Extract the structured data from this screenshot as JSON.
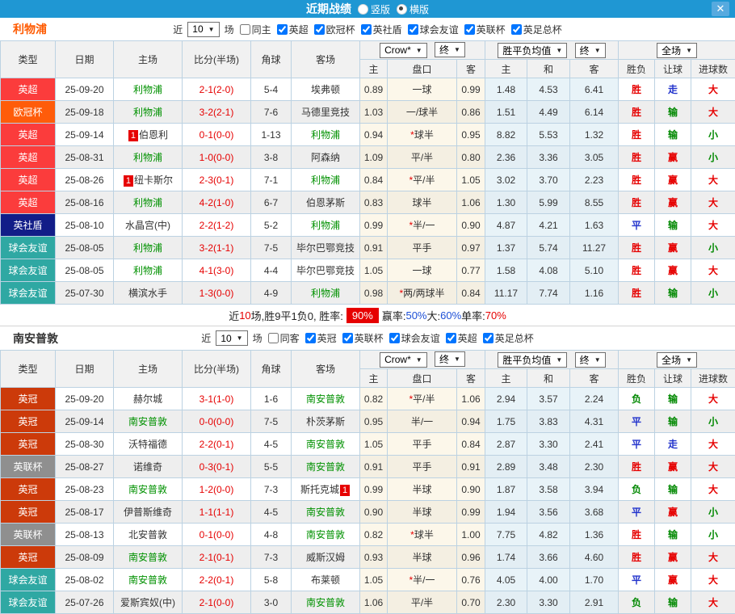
{
  "titlebar": {
    "title": "近期战绩",
    "radio_vertical": "竖版",
    "radio_horizontal": "横版",
    "close": "✕"
  },
  "filters_common": {
    "near_label": "近",
    "near_value": "10",
    "games_label": "场"
  },
  "header": {
    "static_cols": [
      "类型",
      "日期",
      "主场",
      "比分(半场)",
      "角球",
      "客场"
    ],
    "selects": {
      "odds": "Crow*",
      "final1": "终",
      "avg": "胜平负均值",
      "final2": "终",
      "full": "全场"
    },
    "sub_cols": [
      "主",
      "盘口",
      "客",
      "主",
      "和",
      "客",
      "胜负",
      "让球",
      "进球数"
    ]
  },
  "colors": {
    "outcome_map": {
      "胜": "#e60000",
      "平": "#2233cc",
      "负": "#008800",
      "赢": "#e60000",
      "输": "#008800",
      "走": "#2233cc",
      "大": "#e60000",
      "小": "#008800"
    },
    "league_map": {
      "英超": "#fb3c3c",
      "欧冠杯": "#ff5c0a",
      "英社盾": "#121d88",
      "球会友谊": "#2fa8a3",
      "英冠": "#cc3a0a",
      "英联杯": "#8f8f8f"
    },
    "self_team": "#009100",
    "score": "#e60000"
  },
  "teams": [
    {
      "name": "利物浦",
      "name_color": "#ff5a00",
      "same_label": "同主",
      "same_checked": false,
      "leagues": [
        "英超",
        "欧冠杯",
        "英社盾",
        "球会友谊",
        "英联杯",
        "英足总杯"
      ],
      "rows": [
        {
          "l": "英超",
          "d": "25-09-20",
          "h": "利物浦",
          "hs": 1,
          "hb": "",
          "score": "2-1(2-0)",
          "c": "5-4",
          "a": "埃弗顿",
          "as": 0,
          "ab": "",
          "o1": "0.89",
          "st": 0,
          "pan": "一球",
          "o2": "0.99",
          "m1": "1.48",
          "m2": "4.53",
          "m3": "6.41",
          "r": "胜",
          "lt": "走",
          "g": "大"
        },
        {
          "l": "欧冠杯",
          "d": "25-09-18",
          "h": "利物浦",
          "hs": 1,
          "hb": "",
          "score": "3-2(2-1)",
          "c": "7-6",
          "a": "马德里竞技",
          "as": 0,
          "ab": "",
          "o1": "1.03",
          "st": 0,
          "pan": "一/球半",
          "o2": "0.86",
          "m1": "1.51",
          "m2": "4.49",
          "m3": "6.14",
          "r": "胜",
          "lt": "输",
          "g": "大"
        },
        {
          "l": "英超",
          "d": "25-09-14",
          "h": "伯恩利",
          "hs": 0,
          "hb": "1",
          "score": "0-1(0-0)",
          "c": "1-13",
          "a": "利物浦",
          "as": 1,
          "ab": "",
          "o1": "0.94",
          "st": 1,
          "pan": "球半",
          "o2": "0.95",
          "m1": "8.82",
          "m2": "5.53",
          "m3": "1.32",
          "r": "胜",
          "lt": "输",
          "g": "小"
        },
        {
          "l": "英超",
          "d": "25-08-31",
          "h": "利物浦",
          "hs": 1,
          "hb": "",
          "score": "1-0(0-0)",
          "c": "3-8",
          "a": "阿森纳",
          "as": 0,
          "ab": "",
          "o1": "1.09",
          "st": 0,
          "pan": "平/半",
          "o2": "0.80",
          "m1": "2.36",
          "m2": "3.36",
          "m3": "3.05",
          "r": "胜",
          "lt": "赢",
          "g": "小"
        },
        {
          "l": "英超",
          "d": "25-08-26",
          "h": "纽卡斯尔",
          "hs": 0,
          "hb": "1",
          "score": "2-3(0-1)",
          "c": "7-1",
          "a": "利物浦",
          "as": 1,
          "ab": "",
          "o1": "0.84",
          "st": 1,
          "pan": "平/半",
          "o2": "1.05",
          "m1": "3.02",
          "m2": "3.70",
          "m3": "2.23",
          "r": "胜",
          "lt": "赢",
          "g": "大"
        },
        {
          "l": "英超",
          "d": "25-08-16",
          "h": "利物浦",
          "hs": 1,
          "hb": "",
          "score": "4-2(1-0)",
          "c": "6-7",
          "a": "伯恩茅斯",
          "as": 0,
          "ab": "",
          "o1": "0.83",
          "st": 0,
          "pan": "球半",
          "o2": "1.06",
          "m1": "1.30",
          "m2": "5.99",
          "m3": "8.55",
          "r": "胜",
          "lt": "赢",
          "g": "大"
        },
        {
          "l": "英社盾",
          "d": "25-08-10",
          "h": "水晶宫(中)",
          "hs": 0,
          "hb": "",
          "score": "2-2(1-2)",
          "c": "5-2",
          "a": "利物浦",
          "as": 1,
          "ab": "",
          "o1": "0.99",
          "st": 1,
          "pan": "半/一",
          "o2": "0.90",
          "m1": "4.87",
          "m2": "4.21",
          "m3": "1.63",
          "r": "平",
          "lt": "输",
          "g": "大"
        },
        {
          "l": "球会友谊",
          "d": "25-08-05",
          "h": "利物浦",
          "hs": 1,
          "hb": "",
          "score": "3-2(1-1)",
          "c": "7-5",
          "a": "毕尔巴鄂竞技",
          "as": 0,
          "ab": "",
          "o1": "0.91",
          "st": 0,
          "pan": "平手",
          "o2": "0.97",
          "m1": "1.37",
          "m2": "5.74",
          "m3": "11.27",
          "r": "胜",
          "lt": "赢",
          "g": "小"
        },
        {
          "l": "球会友谊",
          "d": "25-08-05",
          "h": "利物浦",
          "hs": 1,
          "hb": "",
          "score": "4-1(3-0)",
          "c": "4-4",
          "a": "毕尔巴鄂竞技",
          "as": 0,
          "ab": "",
          "o1": "1.05",
          "st": 0,
          "pan": "一球",
          "o2": "0.77",
          "m1": "1.58",
          "m2": "4.08",
          "m3": "5.10",
          "r": "胜",
          "lt": "赢",
          "g": "大"
        },
        {
          "l": "球会友谊",
          "d": "25-07-30",
          "h": "横滨水手",
          "hs": 0,
          "hb": "",
          "score": "1-3(0-0)",
          "c": "4-9",
          "a": "利物浦",
          "as": 1,
          "ab": "",
          "o1": "0.98",
          "st": 1,
          "pan": "两/两球半",
          "o2": "0.84",
          "m1": "11.17",
          "m2": "7.74",
          "m3": "1.16",
          "r": "胜",
          "lt": "输",
          "g": "小"
        }
      ],
      "summary": [
        {
          "t": "近"
        },
        {
          "t": "10",
          "s": "red"
        },
        {
          "t": "场,胜9平1负0, 胜率:"
        },
        {
          "t": "90%",
          "s": "redbox"
        },
        {
          "t": "赢率:"
        },
        {
          "t": "50%",
          "s": "blue"
        },
        {
          "t": " 大:"
        },
        {
          "t": "60%",
          "s": "blue"
        },
        {
          "t": " 单率:"
        },
        {
          "t": "70%",
          "s": "red"
        }
      ]
    },
    {
      "name": "南安普敦",
      "name_color": "#333333",
      "same_label": "同客",
      "same_checked": false,
      "leagues": [
        "英冠",
        "英联杯",
        "球会友谊",
        "英超",
        "英足总杯"
      ],
      "rows": [
        {
          "l": "英冠",
          "d": "25-09-20",
          "h": "赫尔城",
          "hs": 0,
          "hb": "",
          "score": "3-1(1-0)",
          "c": "1-6",
          "a": "南安普敦",
          "as": 1,
          "ab": "",
          "o1": "0.82",
          "st": 1,
          "pan": "平/半",
          "o2": "1.06",
          "m1": "2.94",
          "m2": "3.57",
          "m3": "2.24",
          "r": "负",
          "lt": "输",
          "g": "大"
        },
        {
          "l": "英冠",
          "d": "25-09-14",
          "h": "南安普敦",
          "hs": 1,
          "hb": "",
          "score": "0-0(0-0)",
          "c": "7-5",
          "a": "朴茨茅斯",
          "as": 0,
          "ab": "",
          "o1": "0.95",
          "st": 0,
          "pan": "半/一",
          "o2": "0.94",
          "m1": "1.75",
          "m2": "3.83",
          "m3": "4.31",
          "r": "平",
          "lt": "输",
          "g": "小"
        },
        {
          "l": "英冠",
          "d": "25-08-30",
          "h": "沃特福德",
          "hs": 0,
          "hb": "",
          "score": "2-2(0-1)",
          "c": "4-5",
          "a": "南安普敦",
          "as": 1,
          "ab": "",
          "o1": "1.05",
          "st": 0,
          "pan": "平手",
          "o2": "0.84",
          "m1": "2.87",
          "m2": "3.30",
          "m3": "2.41",
          "r": "平",
          "lt": "走",
          "g": "大"
        },
        {
          "l": "英联杯",
          "d": "25-08-27",
          "h": "诺维奇",
          "hs": 0,
          "hb": "",
          "score": "0-3(0-1)",
          "c": "5-5",
          "a": "南安普敦",
          "as": 1,
          "ab": "",
          "o1": "0.91",
          "st": 0,
          "pan": "平手",
          "o2": "0.91",
          "m1": "2.89",
          "m2": "3.48",
          "m3": "2.30",
          "r": "胜",
          "lt": "赢",
          "g": "大"
        },
        {
          "l": "英冠",
          "d": "25-08-23",
          "h": "南安普敦",
          "hs": 1,
          "hb": "",
          "score": "1-2(0-0)",
          "c": "7-3",
          "a": "斯托克城",
          "as": 0,
          "ab": "1",
          "o1": "0.99",
          "st": 0,
          "pan": "半球",
          "o2": "0.90",
          "m1": "1.87",
          "m2": "3.58",
          "m3": "3.94",
          "r": "负",
          "lt": "输",
          "g": "大"
        },
        {
          "l": "英冠",
          "d": "25-08-17",
          "h": "伊普斯维奇",
          "hs": 0,
          "hb": "",
          "score": "1-1(1-1)",
          "c": "4-5",
          "a": "南安普敦",
          "as": 1,
          "ab": "",
          "o1": "0.90",
          "st": 0,
          "pan": "半球",
          "o2": "0.99",
          "m1": "1.94",
          "m2": "3.56",
          "m3": "3.68",
          "r": "平",
          "lt": "赢",
          "g": "小"
        },
        {
          "l": "英联杯",
          "d": "25-08-13",
          "h": "北安普敦",
          "hs": 0,
          "hb": "",
          "score": "0-1(0-0)",
          "c": "4-8",
          "a": "南安普敦",
          "as": 1,
          "ab": "",
          "o1": "0.82",
          "st": 1,
          "pan": "球半",
          "o2": "1.00",
          "m1": "7.75",
          "m2": "4.82",
          "m3": "1.36",
          "r": "胜",
          "lt": "输",
          "g": "小"
        },
        {
          "l": "英冠",
          "d": "25-08-09",
          "h": "南安普敦",
          "hs": 1,
          "hb": "",
          "score": "2-1(0-1)",
          "c": "7-3",
          "a": "威斯汉姆",
          "as": 0,
          "ab": "",
          "o1": "0.93",
          "st": 0,
          "pan": "半球",
          "o2": "0.96",
          "m1": "1.74",
          "m2": "3.66",
          "m3": "4.60",
          "r": "胜",
          "lt": "赢",
          "g": "大"
        },
        {
          "l": "球会友谊",
          "d": "25-08-02",
          "h": "南安普敦",
          "hs": 1,
          "hb": "",
          "score": "2-2(0-1)",
          "c": "5-8",
          "a": "布莱顿",
          "as": 0,
          "ab": "",
          "o1": "1.05",
          "st": 1,
          "pan": "半/一",
          "o2": "0.76",
          "m1": "4.05",
          "m2": "4.00",
          "m3": "1.70",
          "r": "平",
          "lt": "赢",
          "g": "大"
        },
        {
          "l": "球会友谊",
          "d": "25-07-26",
          "h": "爱斯宾奴(中)",
          "hs": 0,
          "hb": "",
          "score": "2-1(0-0)",
          "c": "3-0",
          "a": "南安普敦",
          "as": 1,
          "ab": "",
          "o1": "1.06",
          "st": 0,
          "pan": "平/半",
          "o2": "0.70",
          "m1": "2.30",
          "m2": "3.30",
          "m3": "2.91",
          "r": "负",
          "lt": "输",
          "g": "大"
        }
      ],
      "summary": null
    }
  ]
}
